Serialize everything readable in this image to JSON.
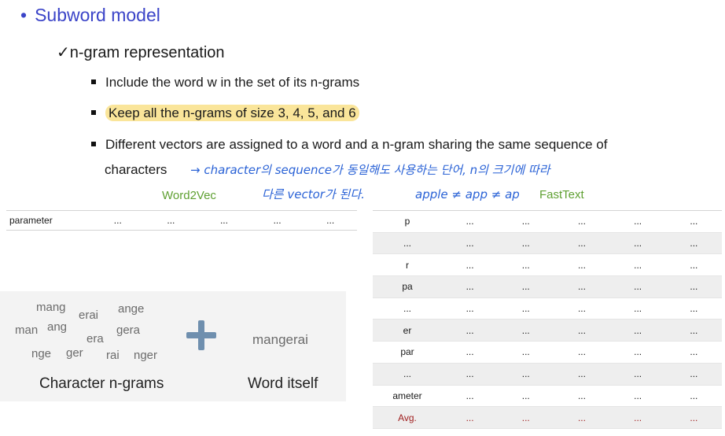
{
  "heading": "Subword model",
  "subheading": "n-gram representation",
  "bullets": [
    "Include the word w in the set of its n-grams",
    "Keep all the n-grams of size 3, 4, 5, and 6",
    "Different vectors are assigned to a word and a n-gram sharing the same sequence of",
    "characters"
  ],
  "handwriting": {
    "line1": "→ character의 sequence가 동일해도 사용하는 단어, n의 크기에 따라",
    "line2": "다른 vector가 된다.",
    "line3": "apple ≠ app ≠ ap"
  },
  "labels": {
    "word2vec": "Word2Vec",
    "fasttext": "FastText"
  },
  "word2vec_table": {
    "word": "parameter",
    "cells": [
      "...",
      "...",
      "...",
      "...",
      "..."
    ]
  },
  "fasttext_table": {
    "rows": [
      {
        "label": "p",
        "cells": [
          "...",
          "...",
          "...",
          "...",
          "..."
        ]
      },
      {
        "label": "...",
        "cells": [
          "...",
          "...",
          "...",
          "...",
          "..."
        ]
      },
      {
        "label": "r",
        "cells": [
          "...",
          "...",
          "...",
          "...",
          "..."
        ]
      },
      {
        "label": "pa",
        "cells": [
          "...",
          "...",
          "...",
          "...",
          "..."
        ]
      },
      {
        "label": "...",
        "cells": [
          "...",
          "...",
          "...",
          "...",
          "..."
        ]
      },
      {
        "label": "er",
        "cells": [
          "...",
          "...",
          "...",
          "...",
          "..."
        ]
      },
      {
        "label": "par",
        "cells": [
          "...",
          "...",
          "...",
          "...",
          "..."
        ]
      },
      {
        "label": "...",
        "cells": [
          "...",
          "...",
          "...",
          "...",
          "..."
        ]
      },
      {
        "label": "ameter",
        "cells": [
          "...",
          "...",
          "...",
          "...",
          "..."
        ]
      },
      {
        "label": "Avg.",
        "cells": [
          "...",
          "...",
          "...",
          "...",
          "..."
        ]
      }
    ]
  },
  "ngrams": [
    "mang",
    "erai",
    "ange",
    "man",
    "ang",
    "gera",
    "era",
    "nge",
    "ger",
    "rai",
    "nger"
  ],
  "word_itself": "mangerai",
  "captions": {
    "char_ngrams": "Character n-grams",
    "word_itself": "Word itself"
  },
  "colors": {
    "heading": "#3b44c8",
    "highlight": "#fae59a",
    "handwriting": "#2a62d6",
    "label": "#5fa032",
    "avg": "#a02020"
  }
}
